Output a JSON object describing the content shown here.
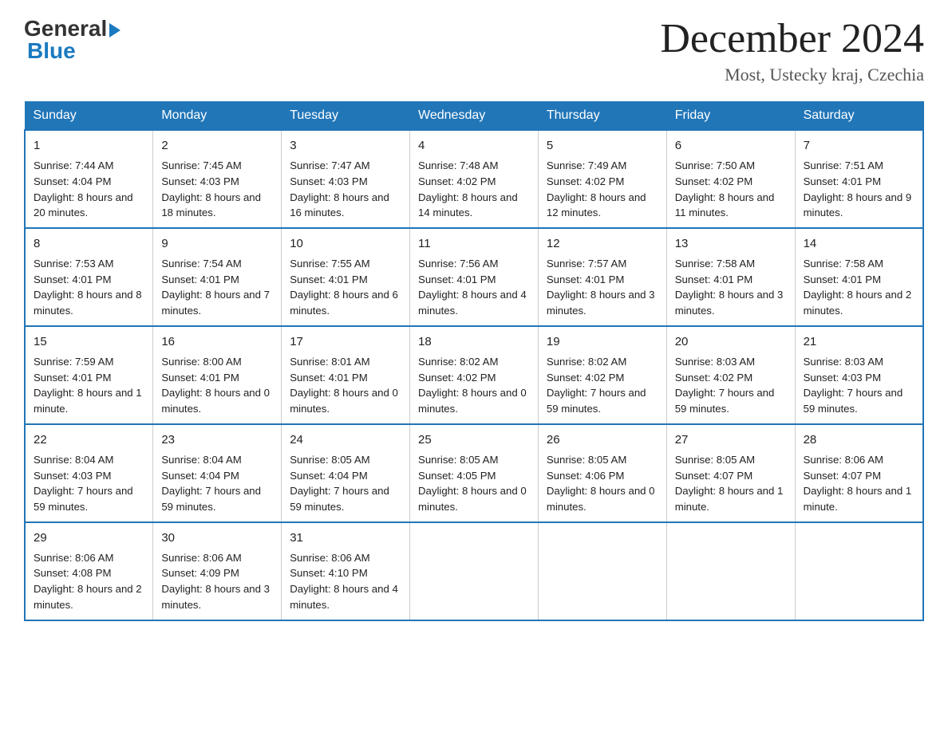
{
  "header": {
    "logo_general": "General",
    "logo_blue": "Blue",
    "month_year": "December 2024",
    "location": "Most, Ustecky kraj, Czechia"
  },
  "days_of_week": [
    "Sunday",
    "Monday",
    "Tuesday",
    "Wednesday",
    "Thursday",
    "Friday",
    "Saturday"
  ],
  "weeks": [
    [
      {
        "day": "1",
        "sunrise": "7:44 AM",
        "sunset": "4:04 PM",
        "daylight": "8 hours and 20 minutes."
      },
      {
        "day": "2",
        "sunrise": "7:45 AM",
        "sunset": "4:03 PM",
        "daylight": "8 hours and 18 minutes."
      },
      {
        "day": "3",
        "sunrise": "7:47 AM",
        "sunset": "4:03 PM",
        "daylight": "8 hours and 16 minutes."
      },
      {
        "day": "4",
        "sunrise": "7:48 AM",
        "sunset": "4:02 PM",
        "daylight": "8 hours and 14 minutes."
      },
      {
        "day": "5",
        "sunrise": "7:49 AM",
        "sunset": "4:02 PM",
        "daylight": "8 hours and 12 minutes."
      },
      {
        "day": "6",
        "sunrise": "7:50 AM",
        "sunset": "4:02 PM",
        "daylight": "8 hours and 11 minutes."
      },
      {
        "day": "7",
        "sunrise": "7:51 AM",
        "sunset": "4:01 PM",
        "daylight": "8 hours and 9 minutes."
      }
    ],
    [
      {
        "day": "8",
        "sunrise": "7:53 AM",
        "sunset": "4:01 PM",
        "daylight": "8 hours and 8 minutes."
      },
      {
        "day": "9",
        "sunrise": "7:54 AM",
        "sunset": "4:01 PM",
        "daylight": "8 hours and 7 minutes."
      },
      {
        "day": "10",
        "sunrise": "7:55 AM",
        "sunset": "4:01 PM",
        "daylight": "8 hours and 6 minutes."
      },
      {
        "day": "11",
        "sunrise": "7:56 AM",
        "sunset": "4:01 PM",
        "daylight": "8 hours and 4 minutes."
      },
      {
        "day": "12",
        "sunrise": "7:57 AM",
        "sunset": "4:01 PM",
        "daylight": "8 hours and 3 minutes."
      },
      {
        "day": "13",
        "sunrise": "7:58 AM",
        "sunset": "4:01 PM",
        "daylight": "8 hours and 3 minutes."
      },
      {
        "day": "14",
        "sunrise": "7:58 AM",
        "sunset": "4:01 PM",
        "daylight": "8 hours and 2 minutes."
      }
    ],
    [
      {
        "day": "15",
        "sunrise": "7:59 AM",
        "sunset": "4:01 PM",
        "daylight": "8 hours and 1 minute."
      },
      {
        "day": "16",
        "sunrise": "8:00 AM",
        "sunset": "4:01 PM",
        "daylight": "8 hours and 0 minutes."
      },
      {
        "day": "17",
        "sunrise": "8:01 AM",
        "sunset": "4:01 PM",
        "daylight": "8 hours and 0 minutes."
      },
      {
        "day": "18",
        "sunrise": "8:02 AM",
        "sunset": "4:02 PM",
        "daylight": "8 hours and 0 minutes."
      },
      {
        "day": "19",
        "sunrise": "8:02 AM",
        "sunset": "4:02 PM",
        "daylight": "7 hours and 59 minutes."
      },
      {
        "day": "20",
        "sunrise": "8:03 AM",
        "sunset": "4:02 PM",
        "daylight": "7 hours and 59 minutes."
      },
      {
        "day": "21",
        "sunrise": "8:03 AM",
        "sunset": "4:03 PM",
        "daylight": "7 hours and 59 minutes."
      }
    ],
    [
      {
        "day": "22",
        "sunrise": "8:04 AM",
        "sunset": "4:03 PM",
        "daylight": "7 hours and 59 minutes."
      },
      {
        "day": "23",
        "sunrise": "8:04 AM",
        "sunset": "4:04 PM",
        "daylight": "7 hours and 59 minutes."
      },
      {
        "day": "24",
        "sunrise": "8:05 AM",
        "sunset": "4:04 PM",
        "daylight": "7 hours and 59 minutes."
      },
      {
        "day": "25",
        "sunrise": "8:05 AM",
        "sunset": "4:05 PM",
        "daylight": "8 hours and 0 minutes."
      },
      {
        "day": "26",
        "sunrise": "8:05 AM",
        "sunset": "4:06 PM",
        "daylight": "8 hours and 0 minutes."
      },
      {
        "day": "27",
        "sunrise": "8:05 AM",
        "sunset": "4:07 PM",
        "daylight": "8 hours and 1 minute."
      },
      {
        "day": "28",
        "sunrise": "8:06 AM",
        "sunset": "4:07 PM",
        "daylight": "8 hours and 1 minute."
      }
    ],
    [
      {
        "day": "29",
        "sunrise": "8:06 AM",
        "sunset": "4:08 PM",
        "daylight": "8 hours and 2 minutes."
      },
      {
        "day": "30",
        "sunrise": "8:06 AM",
        "sunset": "4:09 PM",
        "daylight": "8 hours and 3 minutes."
      },
      {
        "day": "31",
        "sunrise": "8:06 AM",
        "sunset": "4:10 PM",
        "daylight": "8 hours and 4 minutes."
      },
      null,
      null,
      null,
      null
    ]
  ]
}
